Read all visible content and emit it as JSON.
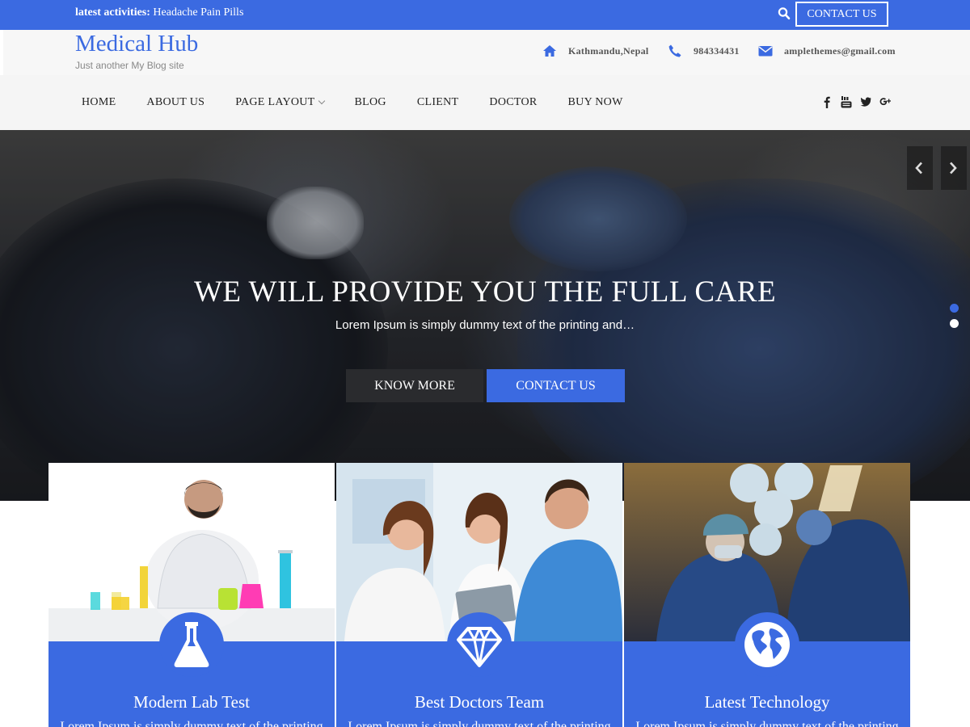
{
  "topbar": {
    "activities_label": "latest activities:",
    "activities_text": "Headache Pain Pills",
    "search_icon": "search-icon",
    "contact_label": "CONTACT US"
  },
  "header": {
    "site_title": "Medical Hub",
    "tagline": "Just another My Blog site",
    "address": "Kathmandu,Nepal",
    "phone": "984334431",
    "email": "amplethemes@gmail.com",
    "icons": [
      "home-icon",
      "phone-icon",
      "envelope-icon"
    ]
  },
  "nav": {
    "items": [
      "HOME",
      "ABOUT US",
      "PAGE LAYOUT",
      "BLOG",
      "CLIENT",
      "DOCTOR",
      "BUY NOW"
    ],
    "dropdown_item": "PAGE LAYOUT",
    "social": [
      "facebook-icon",
      "youtube-icon",
      "twitter-icon",
      "google-plus-icon"
    ]
  },
  "hero": {
    "title": "WE WILL PROVIDE YOU THE FULL CARE",
    "subtitle": "Lorem Ipsum is simply dummy text of the printing and…",
    "know_more": "KNOW MORE",
    "contact": "CONTACT US",
    "slides": 2,
    "active_slide": 1
  },
  "features": [
    {
      "title": "Modern Lab Test",
      "desc": "Lorem Ipsum is simply dummy text of the printing",
      "icon": "flask-icon"
    },
    {
      "title": "Best Doctors Team",
      "desc": "Lorem Ipsum is simply dummy text of the printing",
      "icon": "diamond-icon"
    },
    {
      "title": "Latest Technology",
      "desc": "Lorem Ipsum is simply dummy text of the printing",
      "icon": "globe-icon"
    }
  ],
  "colors": {
    "accent": "#3b6ae1",
    "dark_button": "#2a2b2e",
    "nav_bg": "#f5f5f5"
  }
}
